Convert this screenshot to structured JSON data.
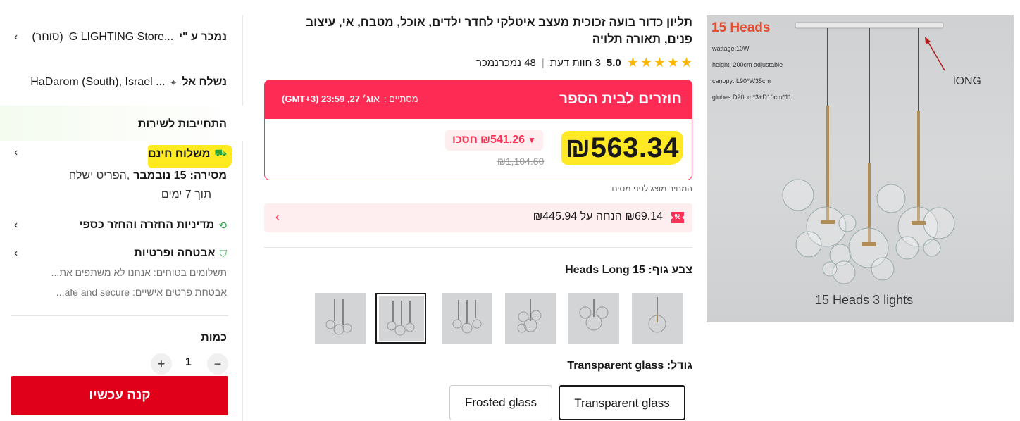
{
  "product": {
    "title": "תליון כדור בועה זכוכית מעצב איטלקי לחדר ילדים, אוכל, מטבח, אי, עיצוב פנים, תאורה תלויה",
    "rating_score": "5.0",
    "reviews": "3 חוות דעת",
    "sold": "48 נמכרנמכר",
    "stars": 5,
    "image": {
      "heading": "15 Heads",
      "specs": [
        "wattage:10W",
        "height: 200cm adjustable",
        "canopy: L90*W35cm",
        "globes:D20cm*3+D10cm*11"
      ],
      "annotation": "lONG",
      "caption": "15 Heads 3 lights"
    }
  },
  "deal": {
    "title": "חוזרים לבית הספר",
    "ends_label": "מסתיים :",
    "ends_time": "אוג׳ 27, 23:59 (GMT+3)",
    "price": "₪563.34",
    "discount_amount": "₪541.26",
    "discount_word": "חסכו",
    "original_price": "₪1,104.60",
    "tax_note": "המחיר מוצג לפני מסים"
  },
  "coupon": {
    "tag": "%",
    "text": "₪69.14 הנחה על ₪445.94",
    "arrow": "‹"
  },
  "options": {
    "color_label": "צבע גוף:",
    "color_value": "15 Heads Long",
    "color_thumbs": [
      "thumb-1",
      "thumb-2",
      "thumb-3",
      "thumb-4",
      "thumb-5",
      "thumb-6"
    ],
    "selected_color_index": 1,
    "size_label": "גודל:",
    "size_value": "Transparent glass",
    "sizes": [
      "Transparent glass",
      "Frosted glass"
    ],
    "selected_size": "Transparent glass"
  },
  "sidebar": {
    "sold_by_label": "נמכר ע \"י",
    "store_name": "G LIGHTING Store...",
    "store_role": "(סוחר)",
    "ship_to_label": "נשלח אל",
    "ship_to_value": "HaDarom (South), Israel ...",
    "service_commitment": "התחייבות לשירות",
    "free_shipping": "משלוח חינם",
    "delivery_label": "מסירה:",
    "delivery_date": "15 נובמבר",
    "delivery_suffix": ",הפריט ישלח",
    "delivery_within": "תוך 7 ימים",
    "returns": "מדיניות החזרה והחזר כספי",
    "security": "אבטחה ופרטיות",
    "security_line1": "תשלומים בטוחים: אנחנו לא משתפים את...",
    "security_line2": "אבטחת פרטים אישיים: afe and secure...",
    "quantity_label": "כמות",
    "quantity": "1",
    "minus": "−",
    "plus": "+",
    "buy_now": "קנה עכשיו"
  },
  "colors": {
    "accent": "#fe2c55",
    "buy_button": "#e1001a",
    "highlight": "#ffea22",
    "star": "#fdb600",
    "green": "#22a340"
  }
}
